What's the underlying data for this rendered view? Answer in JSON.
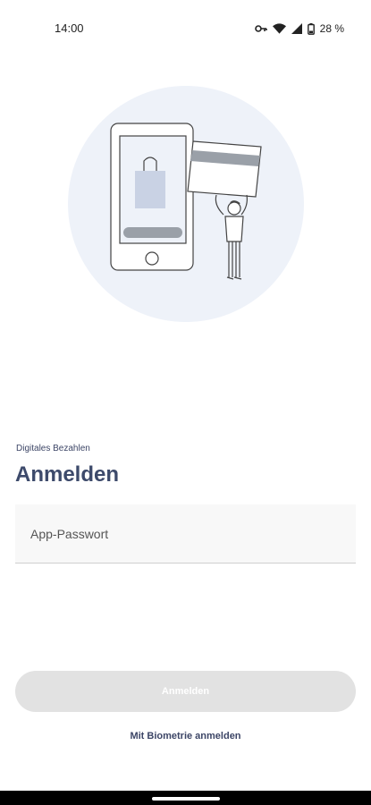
{
  "status_bar": {
    "time": "14:00",
    "battery_text": "28 %",
    "icons": [
      "key-icon",
      "wifi-icon",
      "signal-icon",
      "battery-icon"
    ]
  },
  "illustration": {
    "icon": "phone-payment-card-illustration",
    "circle_color": "#eef2f9"
  },
  "header": {
    "eyebrow": "Digitales Bezahlen",
    "title": "Anmelden"
  },
  "password_field": {
    "placeholder": "App-Passwort",
    "value": ""
  },
  "actions": {
    "login_label": "Anmelden",
    "login_disabled": true,
    "biometric_label": "Mit Biometrie anmelden"
  },
  "colors": {
    "brand_text": "#3d4a6b",
    "button_disabled_bg": "#e2e2e2",
    "field_bg": "#f8f8f8"
  }
}
